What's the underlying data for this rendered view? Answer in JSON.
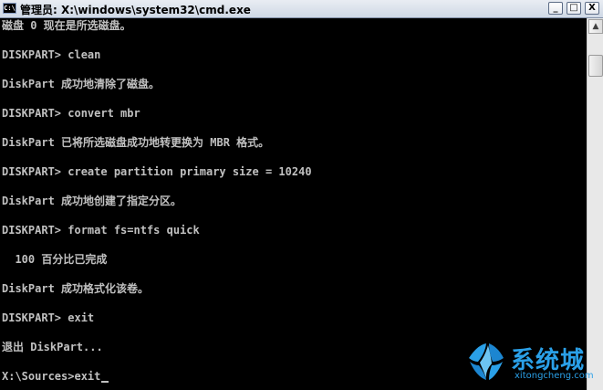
{
  "window": {
    "title": "管理员: X:\\windows\\system32\\cmd.exe",
    "icon_label": "C:\\",
    "minimize_glyph": "_",
    "maximize_glyph": "□",
    "close_glyph": "X"
  },
  "console": {
    "lines": [
      "磁盘 0 现在是所选磁盘。",
      "",
      "DISKPART> clean",
      "",
      "DiskPart 成功地清除了磁盘。",
      "",
      "DISKPART> convert mbr",
      "",
      "DiskPart 已将所选磁盘成功地转更换为 MBR 格式。",
      "",
      "DISKPART> create partition primary size = 10240",
      "",
      "DiskPart 成功地创建了指定分区。",
      "",
      "DISKPART> format fs=ntfs quick",
      "",
      "  100 百分比已完成",
      "",
      "DiskPart 成功格式化该卷。",
      "",
      "DISKPART> exit",
      "",
      "退出 DiskPart...",
      "",
      "X:\\Sources>exit"
    ]
  },
  "scrollbar": {
    "up_glyph": "▲"
  },
  "watermark": {
    "title": "系统城",
    "url": "xitongcheng.com"
  },
  "colors": {
    "console_bg": "#000000",
    "console_text": "#c0c0c0",
    "watermark": "#2aa0e8"
  }
}
